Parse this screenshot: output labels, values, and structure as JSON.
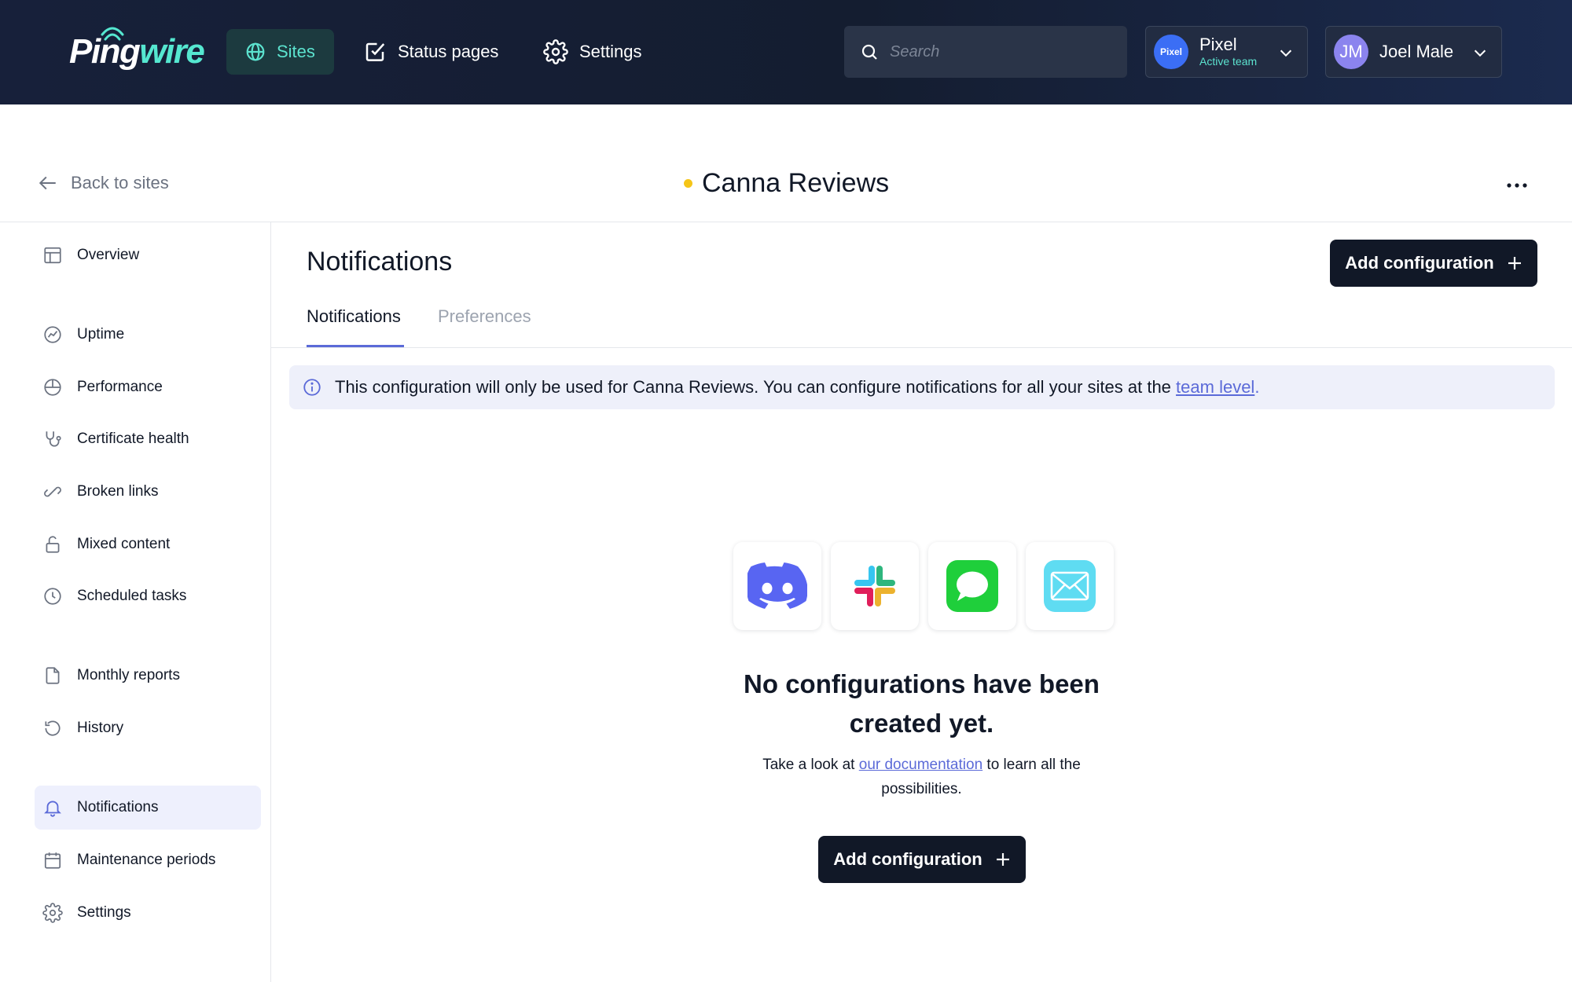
{
  "topbar": {
    "logo": {
      "text_main": "Ping",
      "text_accent": "wire"
    },
    "nav": [
      {
        "label": "Sites",
        "icon": "globe-icon",
        "active": true
      },
      {
        "label": "Status pages",
        "icon": "checkbox-icon",
        "active": false
      },
      {
        "label": "Settings",
        "icon": "gear-icon",
        "active": false
      }
    ],
    "search": {
      "placeholder": "Search"
    },
    "team": {
      "avatar_text": "Pixel",
      "name": "Pixel",
      "subtitle": "Active team"
    },
    "user": {
      "initials": "JM",
      "name": "Joel Male"
    }
  },
  "header": {
    "back_label": "Back to sites",
    "site_name": "Canna Reviews",
    "status_color": "#f5c518"
  },
  "sidebar": {
    "items": [
      {
        "label": "Overview",
        "icon": "layout-icon"
      },
      {
        "label": "Uptime",
        "icon": "uptime-icon"
      },
      {
        "label": "Performance",
        "icon": "gauge-icon"
      },
      {
        "label": "Certificate health",
        "icon": "stethoscope-icon"
      },
      {
        "label": "Broken links",
        "icon": "broken-link-icon"
      },
      {
        "label": "Mixed content",
        "icon": "unlock-icon"
      },
      {
        "label": "Scheduled tasks",
        "icon": "clock-icon"
      },
      {
        "label": "Monthly reports",
        "icon": "file-icon"
      },
      {
        "label": "History",
        "icon": "history-icon"
      },
      {
        "label": "Notifications",
        "icon": "bell-icon",
        "active": true
      },
      {
        "label": "Maintenance periods",
        "icon": "calendar-icon"
      },
      {
        "label": "Settings",
        "icon": "gear-icon"
      }
    ]
  },
  "main": {
    "title": "Notifications",
    "add_button_label": "Add configuration",
    "tabs": [
      {
        "label": "Notifications",
        "active": true
      },
      {
        "label": "Preferences",
        "active": false
      }
    ],
    "banner": {
      "text": "This configuration will only be used for Canna Reviews. You can configure notifications for all your sites at the",
      "link_text": "team level",
      "trailing": "."
    },
    "integrations": [
      "discord-icon",
      "slack-icon",
      "messages-icon",
      "mail-icon"
    ],
    "empty_state": {
      "title": "No configurations have been created yet.",
      "text_before": "Take a look at",
      "link_text": "our documentation",
      "text_after": "to learn all the possibilities.",
      "button_label": "Add configuration"
    }
  },
  "colors": {
    "accent": "#5ce3cf",
    "link": "#5b6ad8",
    "primary_button": "#111827",
    "topbar": "#141d30"
  }
}
